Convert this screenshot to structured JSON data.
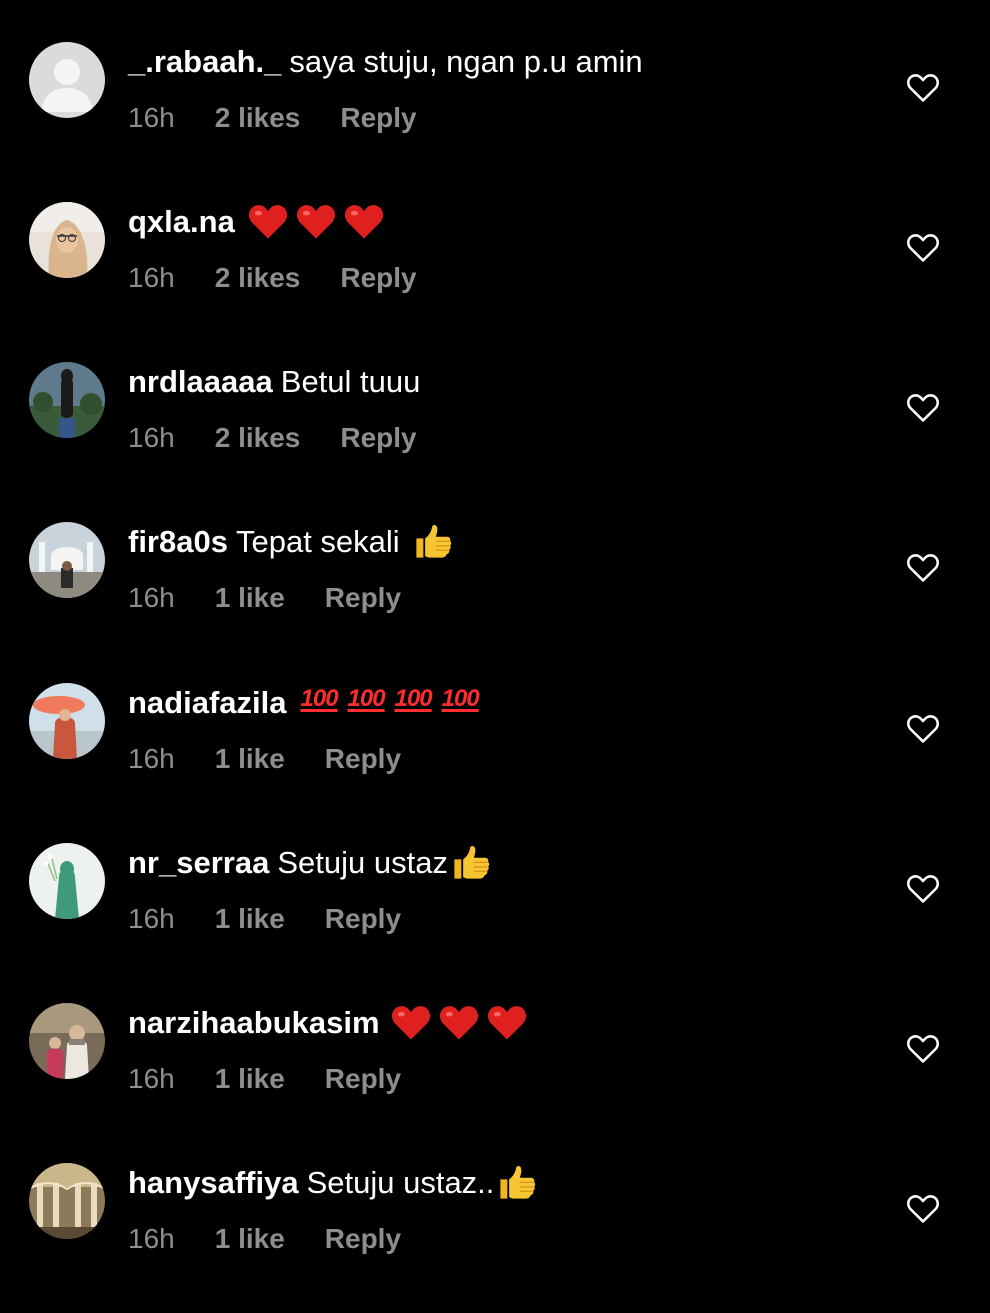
{
  "comments": [
    {
      "username": "_.rabaah._",
      "text": "saya stuju, ngan p.u amin",
      "emojis": [],
      "time": "16h",
      "likes": "2 likes",
      "reply": "Reply",
      "avatar": "default-avatar"
    },
    {
      "username": "qxla.na",
      "text": "",
      "emojis": [
        "red-heart",
        "red-heart",
        "red-heart"
      ],
      "time": "16h",
      "likes": "2 likes",
      "reply": "Reply",
      "avatar": "profile-photo"
    },
    {
      "username": "nrdlaaaaa",
      "text": "Betul tuuu",
      "emojis": [],
      "time": "16h",
      "likes": "2 likes",
      "reply": "Reply",
      "avatar": "profile-photo"
    },
    {
      "username": "fir8a0s",
      "text": "Tepat sekali",
      "emojis": [
        "thumbs-up"
      ],
      "time": "16h",
      "likes": "1 like",
      "reply": "Reply",
      "avatar": "profile-photo"
    },
    {
      "username": "nadiafazila",
      "text": "",
      "emojis": [
        "hundred-points",
        "hundred-points",
        "hundred-points",
        "hundred-points"
      ],
      "time": "16h",
      "likes": "1 like",
      "reply": "Reply",
      "avatar": "profile-photo"
    },
    {
      "username": "nr_serraa",
      "text": "Setuju ustaz",
      "emojis": [
        "thumbs-up"
      ],
      "time": "16h",
      "likes": "1 like",
      "reply": "Reply",
      "avatar": "profile-photo"
    },
    {
      "username": "narzihaabukasim",
      "text": "",
      "emojis": [
        "red-heart",
        "red-heart",
        "red-heart"
      ],
      "time": "16h",
      "likes": "1 like",
      "reply": "Reply",
      "avatar": "profile-photo"
    },
    {
      "username": "hanysaffiya",
      "text": "Setuju ustaz..",
      "emojis": [
        "thumbs-up"
      ],
      "time": "16h",
      "likes": "1 like",
      "reply": "Reply",
      "avatar": "profile-photo"
    }
  ],
  "hundred_label": "100",
  "colors": {
    "background": "#000000",
    "text": "#ffffff",
    "meta": "#8e8e8e",
    "heart_emoji": "#e0201f",
    "hundred_emoji": "#ff2d2d",
    "thumbs_emoji": "#f7c532"
  }
}
